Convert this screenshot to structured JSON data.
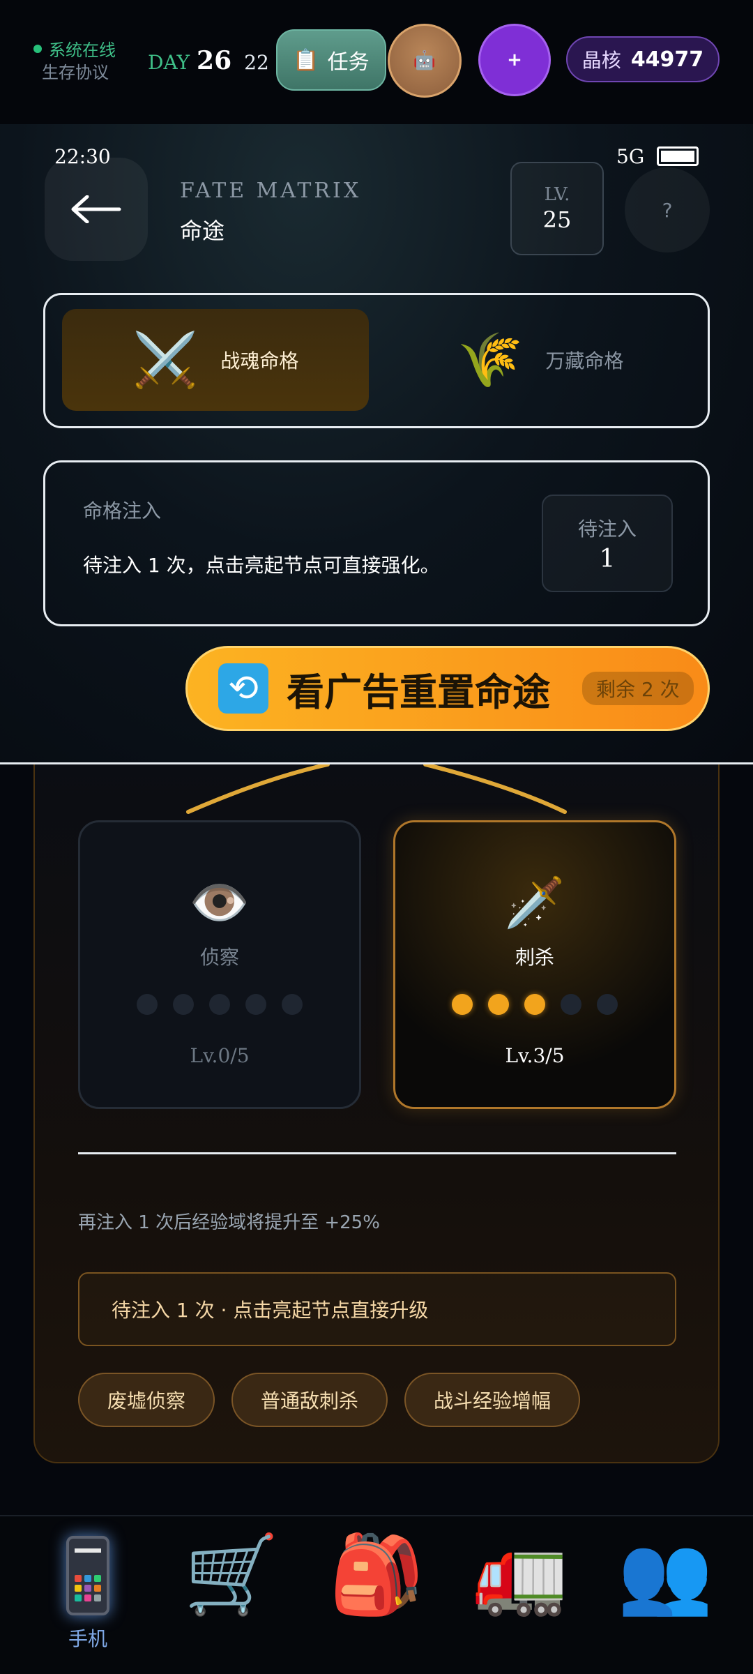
{
  "hud": {
    "status_online": "系统在线",
    "protocol": "生存协议",
    "day_label": "DAY",
    "day_number": "26",
    "day_extra": "22",
    "task_label": "任务",
    "task_icon": "clipboard-icon",
    "robot_icon": "robot-icon",
    "plus_label": "+",
    "crystal_label": "晶核",
    "crystal_value": "44977"
  },
  "phone": {
    "time": "22:30",
    "network": "5G",
    "title_en": "FATE MATRIX",
    "title_zh": "命途",
    "level_label": "LV.",
    "level_value": "25",
    "help_label": "?"
  },
  "tabs": [
    {
      "label": "战魂命格",
      "icon": "crossed-swords-icon",
      "glyph": "⚔️",
      "active": true
    },
    {
      "label": "万藏命格",
      "icon": "wheat-icon",
      "glyph": "🌾",
      "active": false
    }
  ],
  "inject": {
    "label": "命格注入",
    "description": "待注入 1 次，点击亮起节点可直接强化。",
    "pending_label": "待注入",
    "pending_value": "1"
  },
  "ad_button": {
    "label": "看广告重置命途",
    "remaining": "剩余 2 次",
    "icon": "refresh-icon"
  },
  "tree": {
    "nodes": [
      {
        "name": "侦察",
        "icon": "eye-icon",
        "glyph": "👁️",
        "level_text": "Lv.0/5",
        "level": 0,
        "max": 5
      },
      {
        "name": "刺杀",
        "icon": "dagger-icon",
        "glyph": "🗡️",
        "level_text": "Lv.3/5",
        "level": 3,
        "max": 5
      }
    ],
    "bonus_text": "再注入 1 次后经验域将提升至 +25%",
    "upgrade_hint": "待注入 1 次 · 点击亮起节点直接升级",
    "tags": [
      "废墟侦察",
      "普通敌刺杀",
      "战斗经验增幅"
    ]
  },
  "nav": [
    {
      "label": "手机",
      "icon": "phone-icon"
    },
    {
      "label": "",
      "icon": "shopping-cart-icon",
      "glyph": "🛒"
    },
    {
      "label": "",
      "icon": "backpack-icon",
      "glyph": "🎒"
    },
    {
      "label": "",
      "icon": "truck-icon",
      "glyph": "🚛"
    },
    {
      "label": "",
      "icon": "people-icon",
      "glyph": "👥"
    }
  ],
  "colors": {
    "accent_orange": "#f98b18",
    "accent_gold": "#f2a41d",
    "online_green": "#27c07a",
    "crystal_purple": "#7f2fd6"
  }
}
